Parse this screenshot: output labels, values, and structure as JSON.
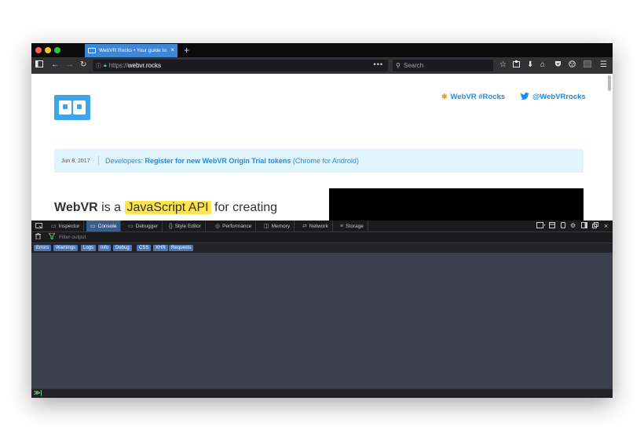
{
  "tab": {
    "title": "WebVR Rocks • Your guide to",
    "close": "×",
    "new_tab": "+"
  },
  "navbar": {
    "back": "←",
    "forward": "→",
    "reload": "↻",
    "url_proto": "https://",
    "url_domain": "webvr.rocks",
    "url_more": "•••",
    "search_placeholder": "Search"
  },
  "toolbar_icons": {
    "star": "☆",
    "downloads": "⬇",
    "home": "⌂",
    "menu": "☰"
  },
  "page": {
    "social1": "WebVR #Rocks",
    "social2": "@WebVRrocks",
    "banner_date": "Jun 8, 2017",
    "banner_prefix": "Developers: ",
    "banner_link": "Register for new WebVR Origin Trial tokens",
    "banner_suffix": " (Chrome for Android)",
    "hero_bold": "WebVR",
    "hero_is": " is a ",
    "hero_highlight": "JavaScript API",
    "hero_rest": " for creating"
  },
  "devtools": {
    "tabs": [
      {
        "label": "Inspector",
        "icon": "▭"
      },
      {
        "label": "Console",
        "icon": "▭"
      },
      {
        "label": "Debugger",
        "icon": "▭"
      },
      {
        "label": "Style Editor",
        "icon": "{}"
      },
      {
        "label": "Performance",
        "icon": "◎"
      },
      {
        "label": "Memory",
        "icon": "◫"
      },
      {
        "label": "Network",
        "icon": "⇄"
      },
      {
        "label": "Storage",
        "icon": "≡"
      }
    ],
    "filter_placeholder": "Filter output",
    "chips": [
      "Errors",
      "Warnings",
      "Logs",
      "Info",
      "Debug",
      "CSS",
      "XHR",
      "Requests"
    ],
    "prompt": "≫|"
  }
}
